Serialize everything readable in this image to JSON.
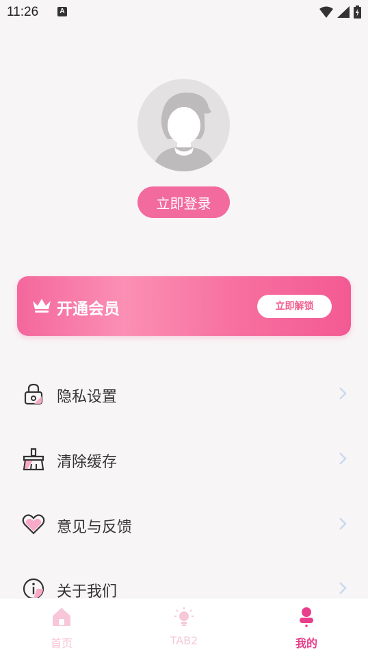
{
  "status_bar": {
    "time": "11:26",
    "notification": "A"
  },
  "profile": {
    "login_button": "立即登录"
  },
  "vip": {
    "title": "开通会员",
    "unlock_button": "立即解锁"
  },
  "menu": [
    {
      "label": "隐私设置",
      "icon": "lock-icon"
    },
    {
      "label": "清除缓存",
      "icon": "broom-icon"
    },
    {
      "label": "意见与反馈",
      "icon": "heart-icon"
    },
    {
      "label": "关于我们",
      "icon": "info-icon"
    }
  ],
  "bottom_nav": [
    {
      "label": "首页",
      "icon": "home-icon",
      "active": false
    },
    {
      "label": "TAB2",
      "icon": "bulb-icon",
      "active": false
    },
    {
      "label": "我的",
      "icon": "person-icon",
      "active": true
    }
  ],
  "colors": {
    "accent": "#f26a9e",
    "nav_inactive": "#f7c6d8",
    "nav_active": "#e83e8c",
    "chevron": "#c9d9f0"
  }
}
